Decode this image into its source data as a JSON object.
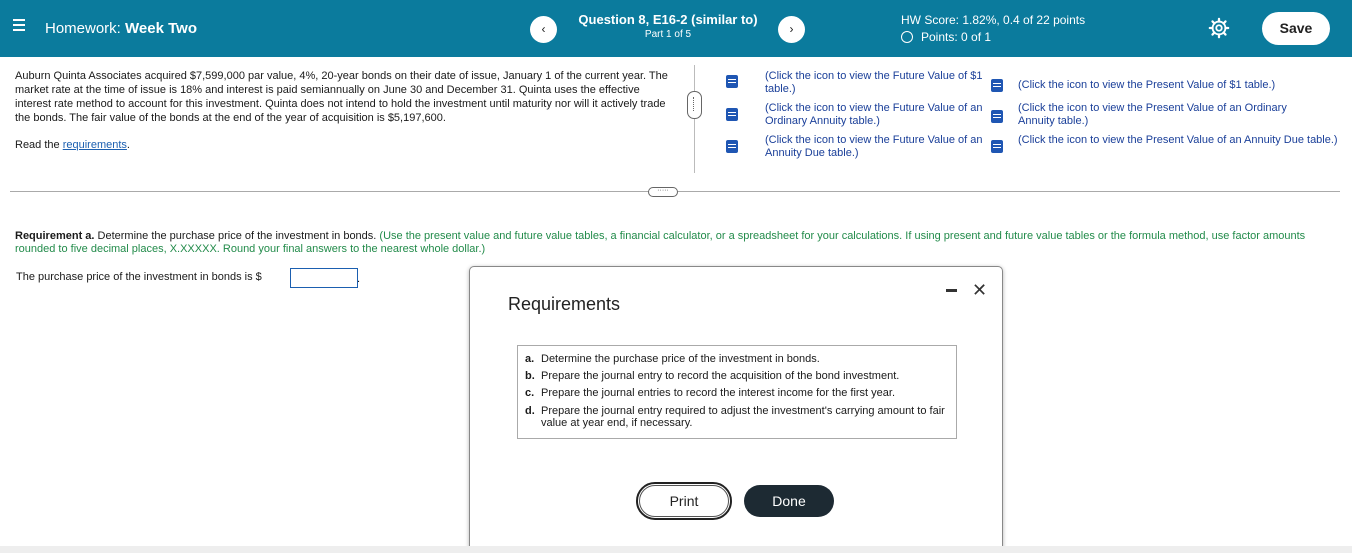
{
  "header": {
    "homework_label": "Homework:",
    "homework_name": "Week Two",
    "prev_icon": "‹",
    "next_icon": "›",
    "question_title": "Question 8, E16-2 (similar to)",
    "question_part": "Part 1 of 5",
    "hw_score": "HW Score: 1.82%, 0.4 of 22 points",
    "points": "Points: 0 of 1",
    "save_label": "Save"
  },
  "problem": {
    "text": "Auburn Quinta Associates acquired $7,599,000 par value, 4%, 20-year bonds on their date of issue, January 1 of the current year. The market rate at the time of issue is 18% and interest is paid semiannually on June 30 and December 31. Quinta uses the effective interest rate method to account for this investment. Quinta does not intend to hold the investment until maturity nor will it actively trade the bonds. The fair value of the bonds at the end of the year of acquisition is $5,197,600.",
    "read_prefix": "Read the",
    "read_link": "requirements",
    "read_suffix": "."
  },
  "tables": {
    "fv1": "(Click the icon to view the Future Value of $1 table.)",
    "fv_ordinary": "(Click the icon to view the Future Value of an Ordinary Annuity table.)",
    "fv_due": "(Click the icon to view the Future Value of an Annuity Due table.)",
    "pv1": "(Click the icon to view the Present Value of $1 table.)",
    "pv_ordinary": "(Click the icon to view the Present Value of an Ordinary Annuity table.)",
    "pv_due": "(Click the icon to view the Present Value of an Annuity Due table.)"
  },
  "requirement_a": {
    "label": "Requirement a.",
    "text": "Determine the purchase price of the investment in bonds.",
    "hint": "(Use the present value and future value tables, a financial calculator, or a spreadsheet for your calculations. If using present and future value tables or the formula method, use factor amounts rounded to five decimal places, X.XXXXX. Round your final answers to the nearest whole dollar.)",
    "answer_prefix": "The purchase price of the investment in bonds is $",
    "answer_value": "",
    "answer_suffix": "."
  },
  "modal": {
    "title": "Requirements",
    "items": [
      {
        "letter": "a.",
        "text": "Determine the purchase price of the investment in bonds."
      },
      {
        "letter": "b.",
        "text": "Prepare the journal entry to record the acquisition of the bond investment."
      },
      {
        "letter": "c.",
        "text": "Prepare the journal entries to record the interest income for the first year."
      },
      {
        "letter": "d.",
        "text": "Prepare the journal entry required to adjust the investment's carrying amount to fair value at year end, if necessary."
      }
    ],
    "print_label": "Print",
    "done_label": "Done"
  },
  "colors": {
    "header_bg": "#0b7b9d",
    "hint_green": "#228b4a",
    "link_blue": "#1b5fb0",
    "done_bg": "#1d2a33"
  }
}
